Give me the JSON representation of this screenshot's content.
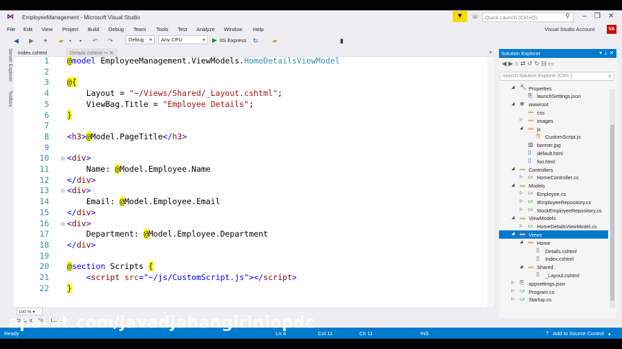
{
  "window": {
    "title": "EmployeeManagement - Microsoft Visual Studio",
    "quick_launch_placeholder": "Quick Launch (Ctrl+Q)",
    "account": "Visual Studio Account",
    "avatar": "VA"
  },
  "menu": [
    "File",
    "Edit",
    "View",
    "Project",
    "Build",
    "Debug",
    "Team",
    "Tools",
    "Test",
    "Analyze",
    "Window",
    "Help"
  ],
  "toolbar": {
    "config": "Debug",
    "platform": "Any CPU",
    "run": "IIS Express"
  },
  "side_strip": [
    "Server Explorer",
    "Toolbox"
  ],
  "tabs": [
    {
      "label": "Index.cshtml"
    },
    {
      "label": "Details.cshtml"
    }
  ],
  "code": [
    [
      [
        "at",
        "@"
      ],
      [
        "kw",
        "model"
      ],
      [
        "txt",
        " EmployeeManagement.ViewModels."
      ],
      [
        "typ",
        "HomeDetailsViewModel"
      ]
    ],
    [],
    [
      [
        "at",
        "@{"
      ]
    ],
    [
      [
        "txt",
        "    Layout = "
      ],
      [
        "str",
        "\"~/Views/Shared/_Layout.cshtml\""
      ],
      [
        "txt",
        ";"
      ]
    ],
    [
      [
        "txt",
        "    ViewBag.Title = "
      ],
      [
        "str",
        "\"Employee Details\""
      ],
      [
        "txt",
        ";"
      ]
    ],
    [
      [
        "at",
        "}"
      ]
    ],
    [],
    [
      [
        "kw",
        "<"
      ],
      [
        "tag",
        "h3"
      ],
      [
        "kw",
        ">"
      ],
      [
        "at",
        "@"
      ],
      [
        "txt",
        "Model.PageTitle"
      ],
      [
        "kw",
        "</"
      ],
      [
        "tag",
        "h3"
      ],
      [
        "kw",
        ">"
      ]
    ],
    [],
    [
      [
        "kw",
        "<"
      ],
      [
        "tag",
        "div"
      ],
      [
        "kw",
        ">"
      ]
    ],
    [
      [
        "txt",
        "    Name: "
      ],
      [
        "at",
        "@"
      ],
      [
        "txt",
        "Model.Employee.Name"
      ]
    ],
    [
      [
        "kw",
        "</"
      ],
      [
        "tag",
        "div"
      ],
      [
        "kw",
        ">"
      ]
    ],
    [
      [
        "kw",
        "<"
      ],
      [
        "tag",
        "div"
      ],
      [
        "kw",
        ">"
      ]
    ],
    [
      [
        "txt",
        "    Email: "
      ],
      [
        "at",
        "@"
      ],
      [
        "txt",
        "Model.Employee.Email"
      ]
    ],
    [
      [
        "kw",
        "</"
      ],
      [
        "tag",
        "div"
      ],
      [
        "kw",
        ">"
      ]
    ],
    [
      [
        "kw",
        "<"
      ],
      [
        "tag",
        "div"
      ],
      [
        "kw",
        ">"
      ]
    ],
    [
      [
        "txt",
        "    Department: "
      ],
      [
        "at",
        "@"
      ],
      [
        "txt",
        "Model.Employee.Department"
      ]
    ],
    [
      [
        "kw",
        "</"
      ],
      [
        "tag",
        "div"
      ],
      [
        "kw",
        ">"
      ]
    ],
    [],
    [
      [
        "at",
        "@"
      ],
      [
        "kw",
        "section"
      ],
      [
        "txt",
        " Scripts "
      ],
      [
        "at",
        "{"
      ]
    ],
    [
      [
        "txt",
        "    "
      ],
      [
        "kw",
        "<"
      ],
      [
        "tag",
        "script"
      ],
      [
        "txt",
        " "
      ],
      [
        "str",
        "src"
      ],
      [
        "kw",
        "="
      ],
      [
        "kw",
        "\"~/js/CustomScript.js\""
      ],
      [
        "kw",
        "></"
      ],
      [
        "tag",
        "script"
      ],
      [
        "kw",
        ">"
      ]
    ],
    [
      [
        "at",
        "}"
      ]
    ]
  ],
  "editor": {
    "zoom": "100 %"
  },
  "bottom_tabs": [
    "Output",
    "Error List ..."
  ],
  "status": {
    "ready": "Ready",
    "ln": "Ln 4",
    "col": "Col 11",
    "ch": "Ch 11",
    "mode": "INS",
    "source_control": "Add to Source Control"
  },
  "watermark": "aparat.com/javadjahangiriniopdc",
  "solution_explorer": {
    "title": "Solution Explorer",
    "search_placeholder": "Search Solution Explorer (Ctrl+;)",
    "items": [
      {
        "label": "Properties",
        "depth": 0,
        "exp": "open",
        "icon": "wrench-icon"
      },
      {
        "label": "launchSettings.json",
        "depth": 1,
        "exp": "",
        "icon": "json-icon"
      },
      {
        "label": "wwwroot",
        "depth": 0,
        "exp": "open",
        "icon": "globe-icon"
      },
      {
        "label": "css",
        "depth": 1,
        "exp": "",
        "icon": "folder-icon"
      },
      {
        "label": "images",
        "depth": 1,
        "exp": "closed",
        "icon": "folder-icon"
      },
      {
        "label": "js",
        "depth": 1,
        "exp": "open",
        "icon": "folder-icon"
      },
      {
        "label": "CustomScript.js",
        "depth": 2,
        "exp": "",
        "icon": "js-file-icon"
      },
      {
        "label": "banner.jpg",
        "depth": 1,
        "exp": "",
        "icon": "image-icon"
      },
      {
        "label": "default.html",
        "depth": 1,
        "exp": "",
        "icon": "html-icon"
      },
      {
        "label": "foo.html",
        "depth": 1,
        "exp": "",
        "icon": "html-icon"
      },
      {
        "label": "Controllers",
        "depth": 0,
        "exp": "open",
        "icon": "folder-icon"
      },
      {
        "label": "HomeController.cs",
        "depth": 1,
        "exp": "closed",
        "icon": "csharp-icon"
      },
      {
        "label": "Models",
        "depth": 0,
        "exp": "open",
        "icon": "folder-icon"
      },
      {
        "label": "Employee.cs",
        "depth": 1,
        "exp": "closed",
        "icon": "csharp-icon"
      },
      {
        "label": "IEmployeeRepository.cs",
        "depth": 1,
        "exp": "closed",
        "icon": "csharp-icon"
      },
      {
        "label": "MockEmployeeRepository.cs",
        "depth": 1,
        "exp": "closed",
        "icon": "csharp-icon"
      },
      {
        "label": "ViewModels",
        "depth": 0,
        "exp": "open",
        "icon": "folder-icon"
      },
      {
        "label": "HomeDetailsViewModel.cs",
        "depth": 1,
        "exp": "closed",
        "icon": "csharp-icon"
      },
      {
        "label": "Views",
        "depth": 0,
        "exp": "open",
        "icon": "folder-icon",
        "selected": true
      },
      {
        "label": "Home",
        "depth": 1,
        "exp": "open",
        "icon": "folder-icon"
      },
      {
        "label": "Details.cshtml",
        "depth": 2,
        "exp": "",
        "icon": "razor-icon"
      },
      {
        "label": "Index.cshtml",
        "depth": 2,
        "exp": "",
        "icon": "razor-icon"
      },
      {
        "label": "Shared",
        "depth": 1,
        "exp": "open",
        "icon": "folder-icon"
      },
      {
        "label": "_Layout.cshtml",
        "depth": 2,
        "exp": "",
        "icon": "razor-icon"
      },
      {
        "label": "appsettings.json",
        "depth": 0,
        "exp": "closed",
        "icon": "json-icon"
      },
      {
        "label": "Program.cs",
        "depth": 0,
        "exp": "closed",
        "icon": "csharp-icon"
      },
      {
        "label": "Startup.cs",
        "depth": 0,
        "exp": "closed",
        "icon": "csharp-icon"
      }
    ]
  },
  "colors": {
    "accent": "#007acc",
    "highlight": "#ffff00",
    "filter": "#ffd800"
  }
}
